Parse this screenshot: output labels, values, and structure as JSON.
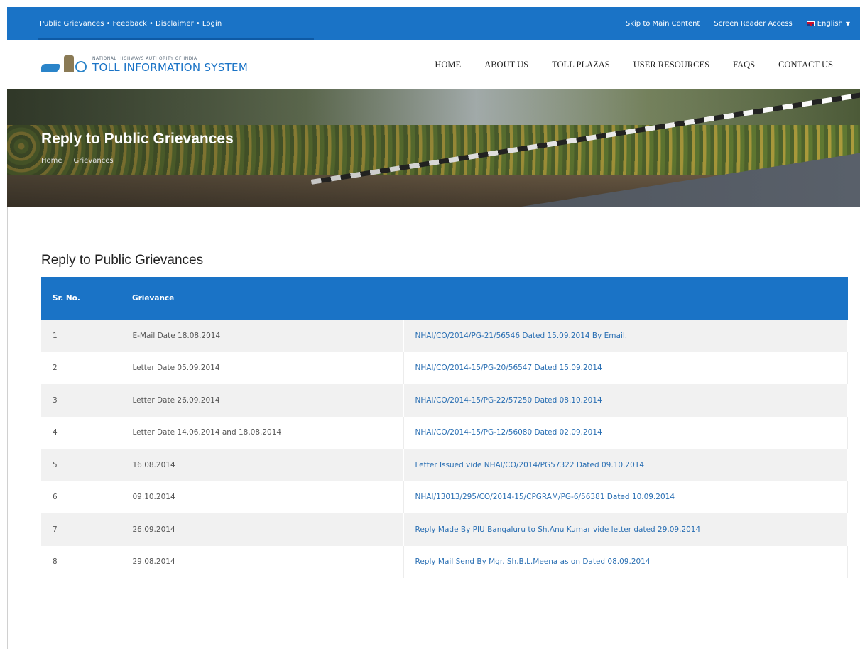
{
  "topbar": {
    "links": [
      "Public Grievances",
      "Feedback",
      "Disclaimer",
      "Login"
    ],
    "separator": "•",
    "skip": "Skip to Main Content",
    "reader": "Screen Reader Access",
    "language": "English"
  },
  "logo": {
    "small": "NATIONAL HIGHWAYS AUTHORITY OF INDIA",
    "big": "TOLL INFORMATION SYSTEM"
  },
  "nav": [
    "HOME",
    "ABOUT US",
    "TOLL PLAZAS",
    "USER RESOURCES",
    "FAQS",
    "CONTACT US"
  ],
  "hero": {
    "title": "Reply to Public Grievances",
    "breadcrumb": [
      "Home",
      "Grievances"
    ]
  },
  "section_title": "Reply to Public Grievances",
  "table": {
    "headers": [
      "Sr. No.",
      "Grievance",
      ""
    ],
    "rows": [
      [
        "1",
        "E-Mail Date 18.08.2014",
        "NHAI/CO/2014/PG-21/56546 Dated 15.09.2014 By Email."
      ],
      [
        "2",
        "Letter Date 05.09.2014",
        "NHAI/CO/2014-15/PG-20/56547 Dated 15.09.2014"
      ],
      [
        "3",
        "Letter Date 26.09.2014",
        "NHAI/CO/2014-15/PG-22/57250 Dated 08.10.2014"
      ],
      [
        "4",
        "Letter Date 14.06.2014 and 18.08.2014",
        "NHAI/CO/2014-15/PG-12/56080 Dated 02.09.2014"
      ],
      [
        "5",
        "16.08.2014",
        "Letter Issued vide NHAI/CO/2014/PG57322 Dated 09.10.2014"
      ],
      [
        "6",
        "09.10.2014",
        "NHAI/13013/295/CO/2014-15/CPGRAM/PG-6/56381 Dated 10.09.2014"
      ],
      [
        "7",
        "26.09.2014",
        "Reply Made By PIU Bangaluru to Sh.Anu Kumar vide letter dated 29.09.2014"
      ],
      [
        "8",
        "29.08.2014",
        "Reply Mail Send By Mgr. Sh.B.L.Meena as on Dated 08.09.2014"
      ]
    ]
  },
  "colors": {
    "primary": "#1a73c6",
    "link": "#2a6fb3",
    "row_alt": "#f1f1f1"
  }
}
